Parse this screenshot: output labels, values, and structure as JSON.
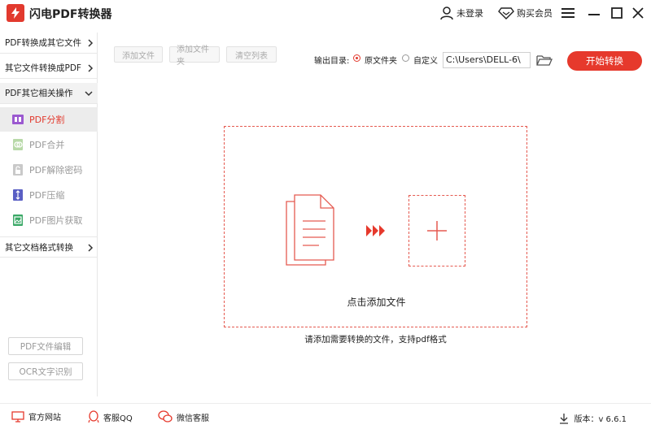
{
  "app": {
    "title": "闪电PDF转换器"
  },
  "titlebar": {
    "login_label": "未登录",
    "vip_label": "购买会员"
  },
  "sidebar": {
    "categories": [
      {
        "label": "PDF转换成其它文件"
      },
      {
        "label": "其它文件转换成PDF"
      },
      {
        "label": "PDF其它相关操作"
      },
      {
        "label": "其它文档格式转换"
      }
    ],
    "subitems": [
      {
        "label": "PDF分割",
        "icon": "pdf-split-icon"
      },
      {
        "label": "PDF合并",
        "icon": "pdf-merge-icon"
      },
      {
        "label": "PDF解除密码",
        "icon": "pdf-unlock-icon"
      },
      {
        "label": "PDF压缩",
        "icon": "pdf-compress-icon"
      },
      {
        "label": "PDF图片获取",
        "icon": "pdf-image-icon"
      }
    ],
    "bottom_buttons": [
      {
        "label": "PDF文件编辑"
      },
      {
        "label": "OCR文字识别"
      }
    ]
  },
  "toolbar": {
    "add_file": "添加文件",
    "add_folder": "添加文件夹",
    "clear_list": "清空列表"
  },
  "output": {
    "label": "输出目录:",
    "option_source": "原文件夹",
    "option_custom": "自定义",
    "path": "C:\\Users\\DELL-6\\",
    "start_label": "开始转换"
  },
  "dropzone": {
    "text": "点击添加文件",
    "hint": "请添加需要转换的文件，支持pdf格式"
  },
  "footer": {
    "website": "官方网站",
    "qq": "客服QQ",
    "wechat": "微信客服",
    "version": "版本：v 6.6.1"
  },
  "colors": {
    "accent": "#e6392c",
    "dash": "#e55a50"
  }
}
